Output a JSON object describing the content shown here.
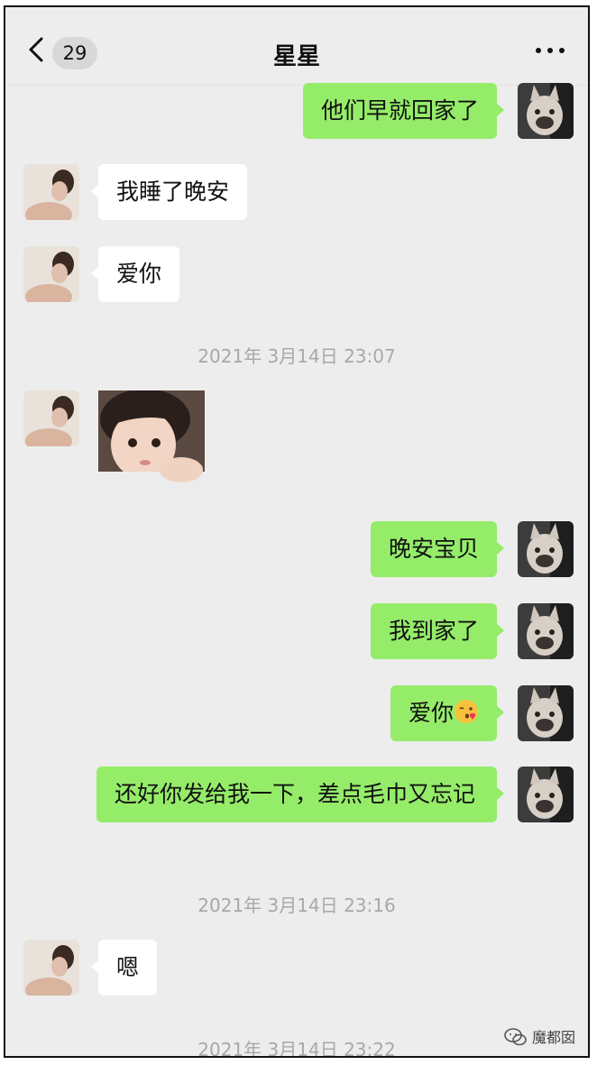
{
  "header": {
    "unread_count": "29",
    "title": "星星",
    "back_icon": "chevron-left-icon",
    "more_icon": "more-dots-icon"
  },
  "messages": [
    {
      "type": "out",
      "text": "他们早就回家了"
    },
    {
      "type": "in",
      "text": "我睡了晚安"
    },
    {
      "type": "in",
      "text": "爱你"
    },
    {
      "type": "time",
      "text": "2021年 3月14日 23:07"
    },
    {
      "type": "in-sticker",
      "sticker": "toddler-photo-sticker"
    },
    {
      "type": "out",
      "text": "晚安宝贝"
    },
    {
      "type": "out",
      "text": "我到家了"
    },
    {
      "type": "out",
      "text": "爱你",
      "emoji": "kissing-face-emoji"
    },
    {
      "type": "out",
      "text": "还好你发给我一下，差点毛巾又忘记"
    },
    {
      "type": "time",
      "text": "2021年 3月14日 23:16"
    },
    {
      "type": "in",
      "text": "嗯"
    },
    {
      "type": "time",
      "text": "2021年 3月14日 23:22"
    }
  ],
  "watermark": {
    "text": "魔都囡",
    "icon": "wechat-logo-icon"
  },
  "colors": {
    "background": "#ededed",
    "outgoing_bubble": "#95ec69",
    "incoming_bubble": "#ffffff",
    "timestamp_text": "#a8a8a8"
  }
}
